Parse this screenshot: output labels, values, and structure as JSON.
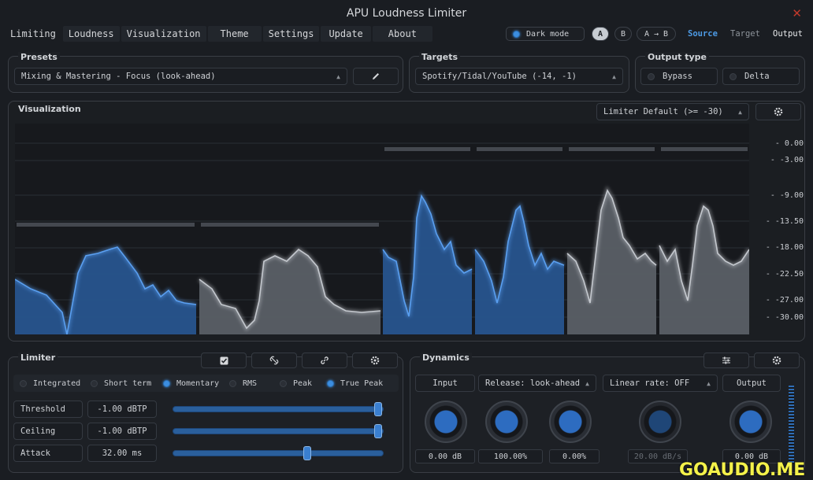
{
  "window": {
    "title": "APU Loudness Limiter",
    "close_glyph": "✕"
  },
  "menu": [
    "Limiting",
    "Loudness",
    "Visualization",
    "Theme",
    "Settings",
    "Update",
    "About"
  ],
  "topbar": {
    "dark_mode_label": "Dark mode",
    "a_label": "A",
    "b_label": "B",
    "ab_label": "A → B",
    "source_label": "Source",
    "target_label": "Target",
    "output_label": "Output"
  },
  "presets": {
    "title": "Presets",
    "value": "Mixing & Mastering - Focus (look-ahead)",
    "edit_icon": "pencil-icon"
  },
  "targets": {
    "title": "Targets",
    "value": "Spotify/Tidal/YouTube (-14, -1)"
  },
  "output_type": {
    "title": "Output type",
    "bypass_label": "Bypass",
    "delta_label": "Delta"
  },
  "visualization": {
    "title": "Visualization",
    "mode_value": "Limiter Default (>= -30)",
    "settings_icon": "gear-icon",
    "axis_labels": [
      "- 0.00",
      "- -3.00",
      "- -9.00",
      "- -13.50",
      "- -18.00",
      "- -22.50",
      "- -27.00",
      "- -30.00"
    ]
  },
  "limiter": {
    "title": "Limiter",
    "tool_icons": [
      "checkbox-icon",
      "unlink-icon",
      "link-icon",
      "gear-icon"
    ],
    "modes": [
      {
        "label": "Integrated",
        "on": false
      },
      {
        "label": "Short term",
        "on": false
      },
      {
        "label": "Momentary",
        "on": true
      },
      {
        "label": "RMS",
        "on": false
      },
      {
        "label": "Peak",
        "on": false
      },
      {
        "label": "True Peak",
        "on": true
      }
    ],
    "params": [
      {
        "label": "Threshold",
        "value": "-1.00 dBTP",
        "level": 1.0
      },
      {
        "label": "Ceiling",
        "value": "-1.00 dBTP",
        "level": 1.0
      },
      {
        "label": "Attack",
        "value": "32.00 ms",
        "level": 0.64
      }
    ]
  },
  "dynamics": {
    "title": "Dynamics",
    "input_label": "Input",
    "release_label": "Release: look-ahead",
    "linear_rate_label": "Linear rate: OFF",
    "output_label": "Output",
    "knob_values": [
      "0.00 dB",
      "100.00%",
      "0.00%",
      "20.00 dB/s",
      "0.00 dB"
    ]
  },
  "watermark": "GOAUDIO.ME"
}
